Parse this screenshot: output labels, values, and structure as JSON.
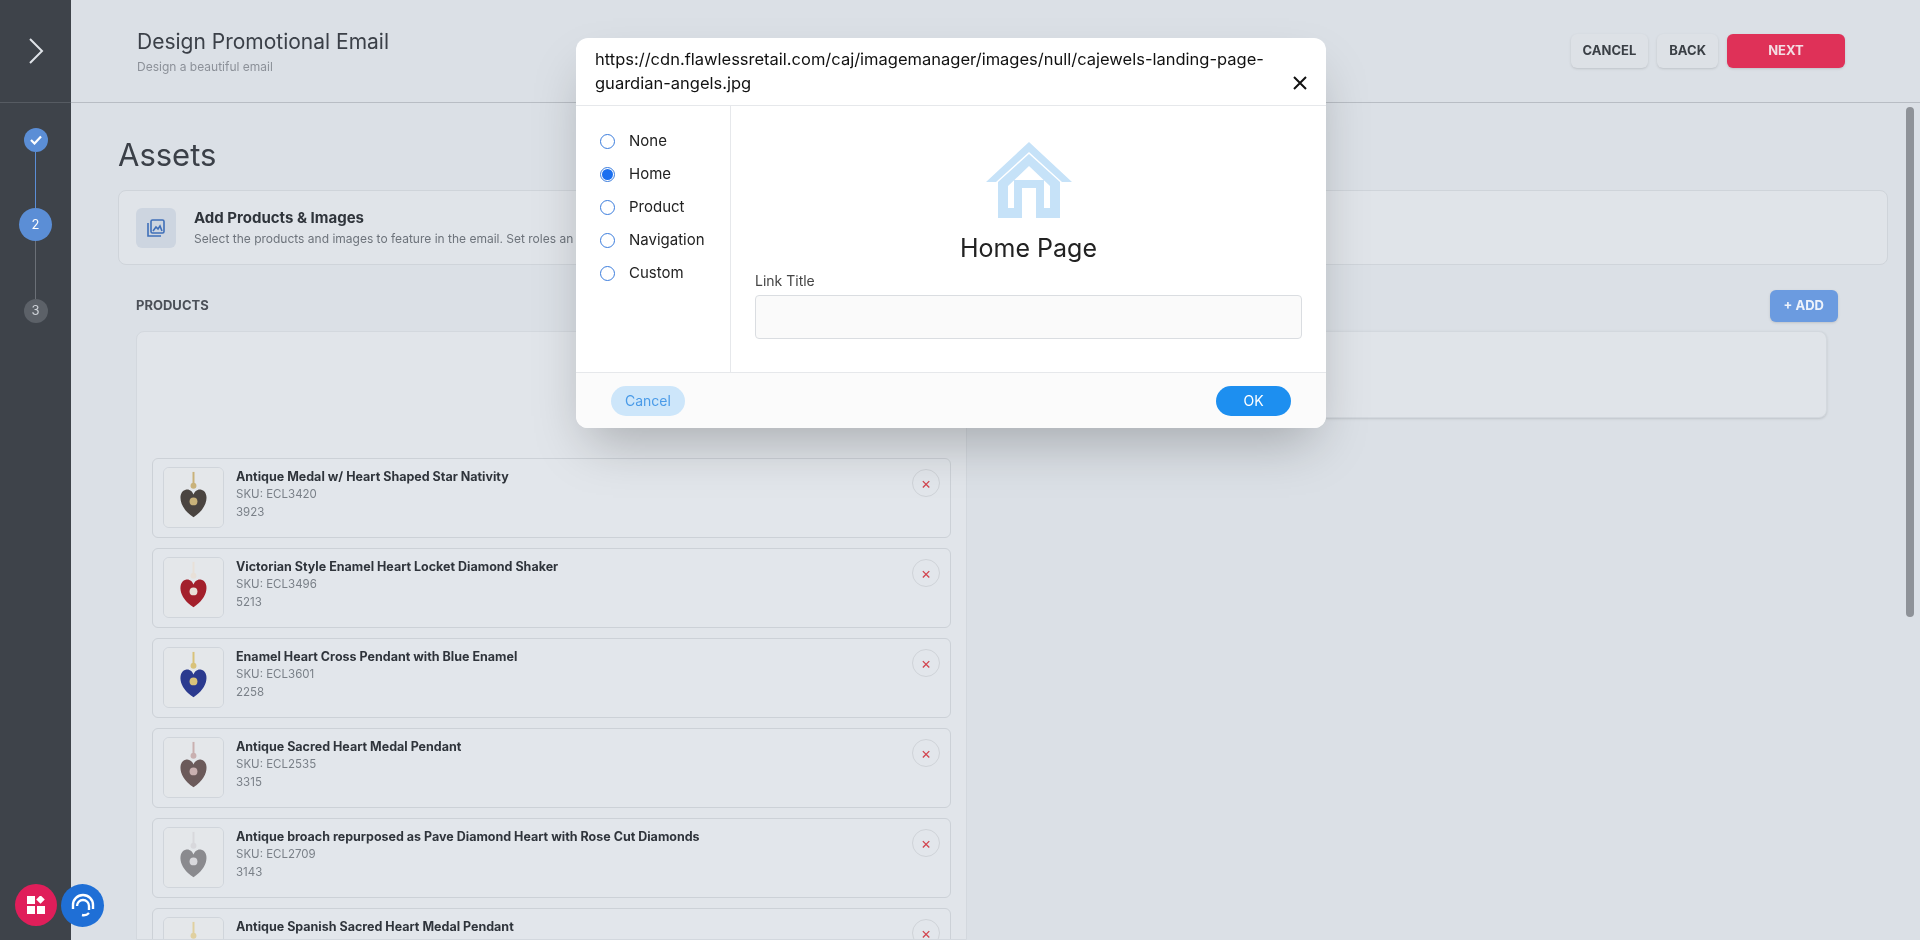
{
  "header": {
    "title": "Design Promotional Email",
    "subtitle": "Design a beautiful email",
    "buttons": [
      {
        "label": "CANCEL",
        "kind": "secondary"
      },
      {
        "label": "BACK",
        "kind": "secondary"
      },
      {
        "label": "NEXT",
        "kind": "primary"
      }
    ]
  },
  "steps": [
    {
      "done": true,
      "selected": false
    },
    {
      "label": "2",
      "done": false,
      "selected": true
    },
    {
      "label": "3",
      "done": false,
      "selected": false
    }
  ],
  "section_title": "Assets",
  "info_card": {
    "title": "Add Products & Images",
    "text": "Select the products and images to feature in the email. Set roles an"
  },
  "products": {
    "label": "PRODUCTS",
    "add_button": "+ ADD",
    "items": [
      {
        "name": "Antique Medal w/ Heart Shaped Star Nativity",
        "sku": "SKU: ECL3420",
        "number": "3923",
        "remove": "×"
      },
      {
        "name": "Victorian Style Enamel Heart Locket Diamond Shaker",
        "sku": "SKU: ECL3496",
        "number": "5213",
        "remove": "×"
      },
      {
        "name": "Enamel Heart Cross Pendant with Blue Enamel",
        "sku": "SKU: ECL3601",
        "number": "2258",
        "remove": "×"
      },
      {
        "name": "Antique Sacred Heart Medal Pendant",
        "sku": "SKU: ECL2535",
        "number": "3315",
        "remove": "×"
      },
      {
        "name": "Antique broach repurposed as Pave Diamond Heart with Rose Cut Diamonds",
        "sku": "SKU: ECL2709",
        "number": "3143",
        "remove": "×"
      },
      {
        "name": "Antique Spanish Sacred Heart Medal Pendant",
        "remove": "×"
      }
    ]
  },
  "dialog": {
    "title": "https://cdn.flawlessretail.com/caj/imagemanager/images/null/cajewels-landing-page-guardian-angels.jpg",
    "options": [
      {
        "label": "None",
        "selected": false
      },
      {
        "label": "Home",
        "selected": true
      },
      {
        "label": "Product",
        "selected": false
      },
      {
        "label": "Navigation",
        "selected": false
      },
      {
        "label": "Custom",
        "selected": false
      }
    ],
    "preview_title": "Home Page",
    "field_label": "Link Title",
    "cancel": "Cancel",
    "ok": "OK"
  }
}
